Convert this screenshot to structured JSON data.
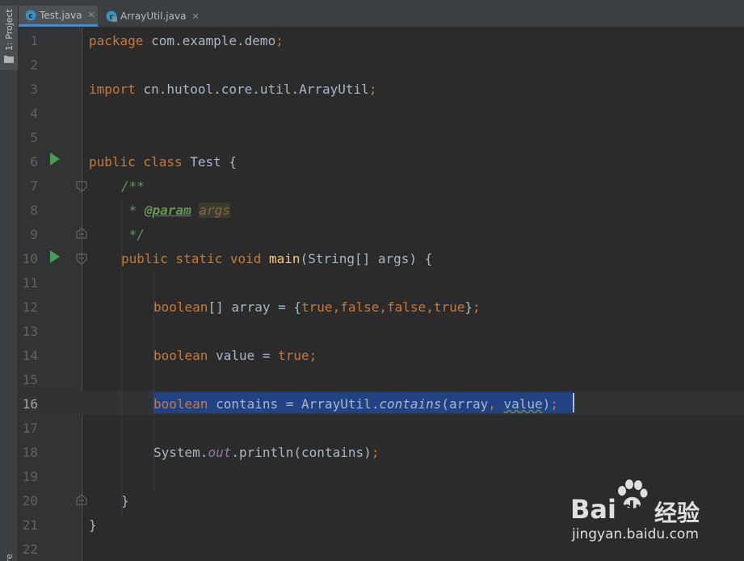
{
  "sidebar": {
    "project_label": "1: Project",
    "bottom_label": "re"
  },
  "tabs": [
    {
      "label": "Test.java",
      "active": true,
      "icon": "java-class-icon"
    },
    {
      "label": "ArrayUtil.java",
      "active": false,
      "icon": "java-class-locked-icon"
    }
  ],
  "line_numbers": [
    "1",
    "2",
    "3",
    "4",
    "5",
    "6",
    "7",
    "8",
    "9",
    "10",
    "11",
    "12",
    "13",
    "14",
    "15",
    "16",
    "17",
    "18",
    "19",
    "20",
    "21",
    "22"
  ],
  "current_line": "16",
  "code": {
    "l1": {
      "kw": "package",
      "rest": " com.example.demo",
      "semi": ";"
    },
    "l3": {
      "kw": "import",
      "rest": " cn.hutool.core.util.ArrayUtil",
      "semi": ";"
    },
    "l6": {
      "kw": "public class",
      "rest": " Test ",
      "brace": "{"
    },
    "l7": {
      "doc": "/**"
    },
    "l8": {
      "star": " * ",
      "tag": "@param",
      "sp": " ",
      "param": "args"
    },
    "l9": {
      "doc": " */"
    },
    "l10": {
      "kw": "public static void",
      "sp": " ",
      "fn": "main",
      "rest": "(String[] args) {"
    },
    "l12": {
      "kw": "boolean",
      "a": "[] array = {",
      "v1": "true",
      "c1": ",",
      "v2": "false",
      "c2": ",",
      "v3": "false",
      "c3": ",",
      "v4": "true",
      "b": "}",
      "semi": ";"
    },
    "l14": {
      "kw": "boolean",
      "a": " value = ",
      "v": "true",
      "semi": ";"
    },
    "l16": {
      "kw": "boolean",
      "a": " contains = ArrayUtil.",
      "call": "contains",
      "b": "(array",
      "c": ",",
      "d": " ",
      "e": "value",
      "f": ")",
      "semi": ";"
    },
    "l18": {
      "a": "System.",
      "field": "out",
      "b": ".println(contains)",
      "semi": ";"
    },
    "l20": {
      "brace": "}"
    },
    "l21": {
      "brace": "}"
    }
  },
  "watermark": {
    "brand": "Bai",
    "brand2": "du",
    "cn": "经验",
    "url": "jingyan.baidu.com"
  },
  "colors": {
    "background": "#2b2b2b",
    "gutter": "#313335",
    "keyword": "#cc7832",
    "method": "#ffc66d",
    "doc": "#629755",
    "selection": "#214283",
    "tab_accent": "#4a88c7"
  }
}
